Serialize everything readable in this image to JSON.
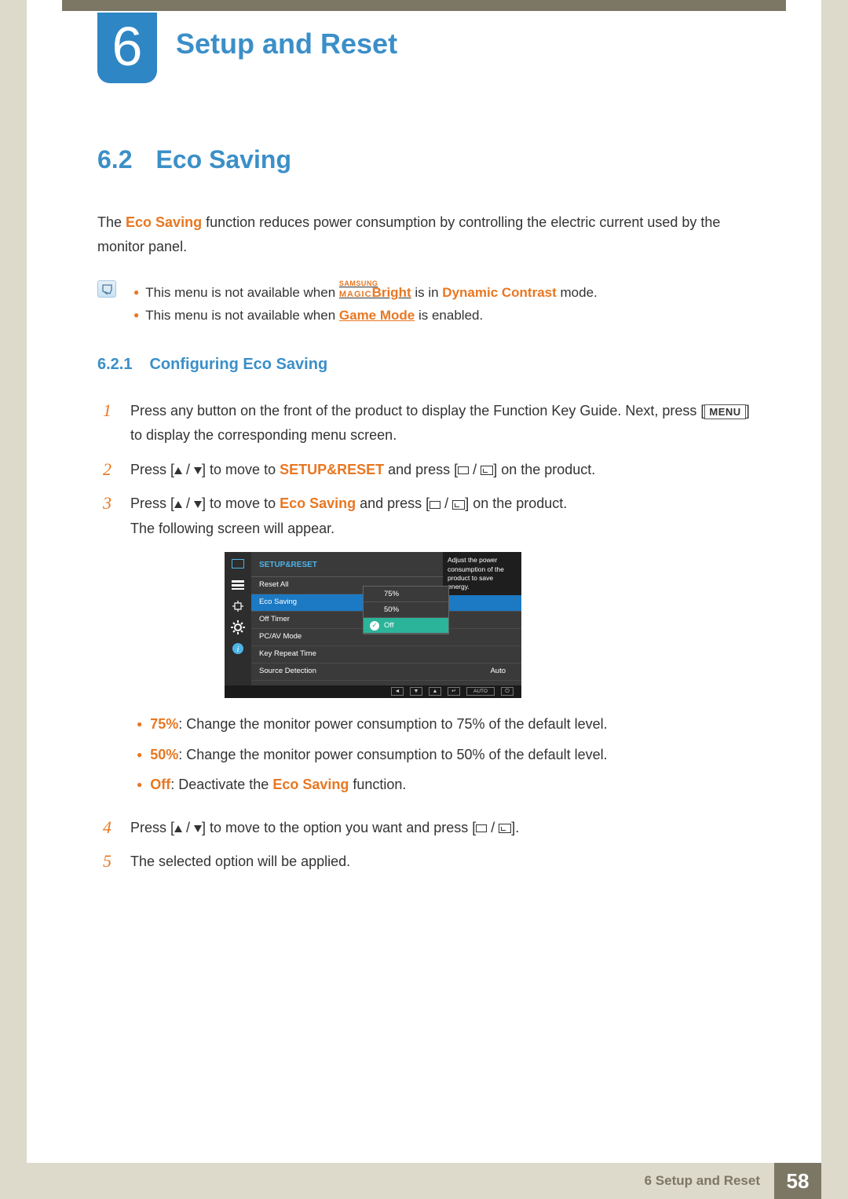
{
  "chapter": {
    "number": "6",
    "title": "Setup and Reset"
  },
  "section": {
    "number": "6.2",
    "title": "Eco Saving"
  },
  "intro": {
    "prefix": "The ",
    "strong": "Eco Saving",
    "suffix": " function reduces power consumption by controlling the electric current used by the monitor panel."
  },
  "notes": {
    "item1": {
      "prefix": "This menu is not available when ",
      "brand_top": "SAMSUNG",
      "brand_left": "MAGIC",
      "brand_right": "Bright",
      "mid": " is in ",
      "mode": "Dynamic Contrast",
      "suffix": " mode."
    },
    "item2": {
      "prefix": "This menu is not available when ",
      "mode": "Game Mode",
      "suffix": " is enabled."
    }
  },
  "subsection": {
    "number": "6.2.1",
    "title": "Configuring Eco Saving"
  },
  "steps": {
    "s1": {
      "part1": "Press any button on the front of the product to display the Function Key Guide. Next, press [",
      "menu": "MENU",
      "part2": "] to display the corresponding menu screen."
    },
    "s2": {
      "a": "Press [",
      "b": "] to move to ",
      "target": "SETUP&RESET",
      "c": " and press [",
      "d": "] on the product."
    },
    "s3": {
      "a": "Press [",
      "b": "] to move to ",
      "target": "Eco Saving",
      "c": " and press [",
      "d": "] on the product.",
      "tail": "The following screen will appear."
    },
    "s4": {
      "a": "Press [",
      "b": "] to move to the option you want and press [",
      "c": "]."
    },
    "s5": "The selected option will be applied."
  },
  "options": {
    "opt75": {
      "label": "75%",
      "desc": ": Change the monitor power consumption to 75% of the default level."
    },
    "opt50": {
      "label": "50%",
      "desc": ": Change the monitor power consumption to 50% of the default level."
    },
    "optOff": {
      "label": "Off",
      "mid": ": Deactivate the ",
      "fn": "Eco Saving",
      "suffix": " function."
    }
  },
  "osd": {
    "header": "SETUP&RESET",
    "rows": {
      "reset": "Reset All",
      "eco": "Eco Saving",
      "off_timer": "Off Timer",
      "pcav": "PC/AV Mode",
      "key_repeat": "Key Repeat Time",
      "source_det": "Source Detection",
      "source_val": "Auto"
    },
    "dropdown": {
      "o75": "75%",
      "o50": "50%",
      "oOff": "Off"
    },
    "tooltip": "Adjust the power consumption of the product to save energy.",
    "nav": {
      "auto": "AUTO"
    }
  },
  "footer": {
    "chapter_label": "6 Setup and Reset",
    "page": "58"
  }
}
